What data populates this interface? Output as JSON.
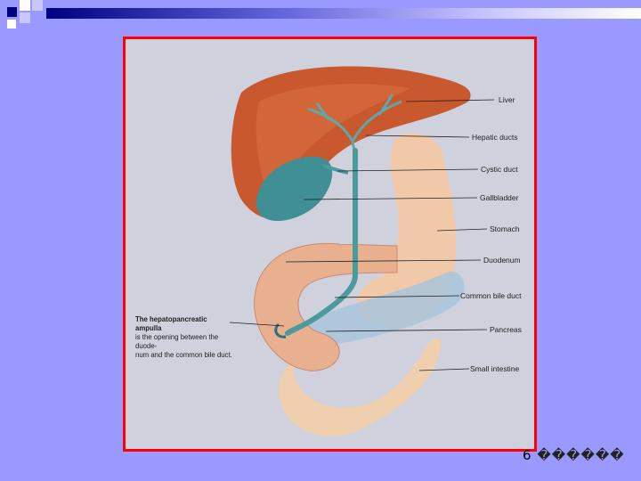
{
  "slide": {
    "background": "#9999ff",
    "frame_border_color": "#ff0000"
  },
  "figure": {
    "labels": {
      "liver": "Liver",
      "hepatic_ducts": "Hepatic ducts",
      "cystic_duct": "Cystic duct",
      "gallbladder": "Gallbladder",
      "stomach": "Stomach",
      "duodenum": "Duodenum",
      "common_bile_duct": "Common bile duct",
      "pancreas": "Pancreas",
      "small_intestine": "Small intestine"
    },
    "note": {
      "line1": "The hepatopancreatic ampulla",
      "line2": "is the opening between the duode-",
      "line3": "num and the common bile duct."
    }
  },
  "footer": {
    "marker": "",
    "page": "6",
    "garbled": "������"
  }
}
